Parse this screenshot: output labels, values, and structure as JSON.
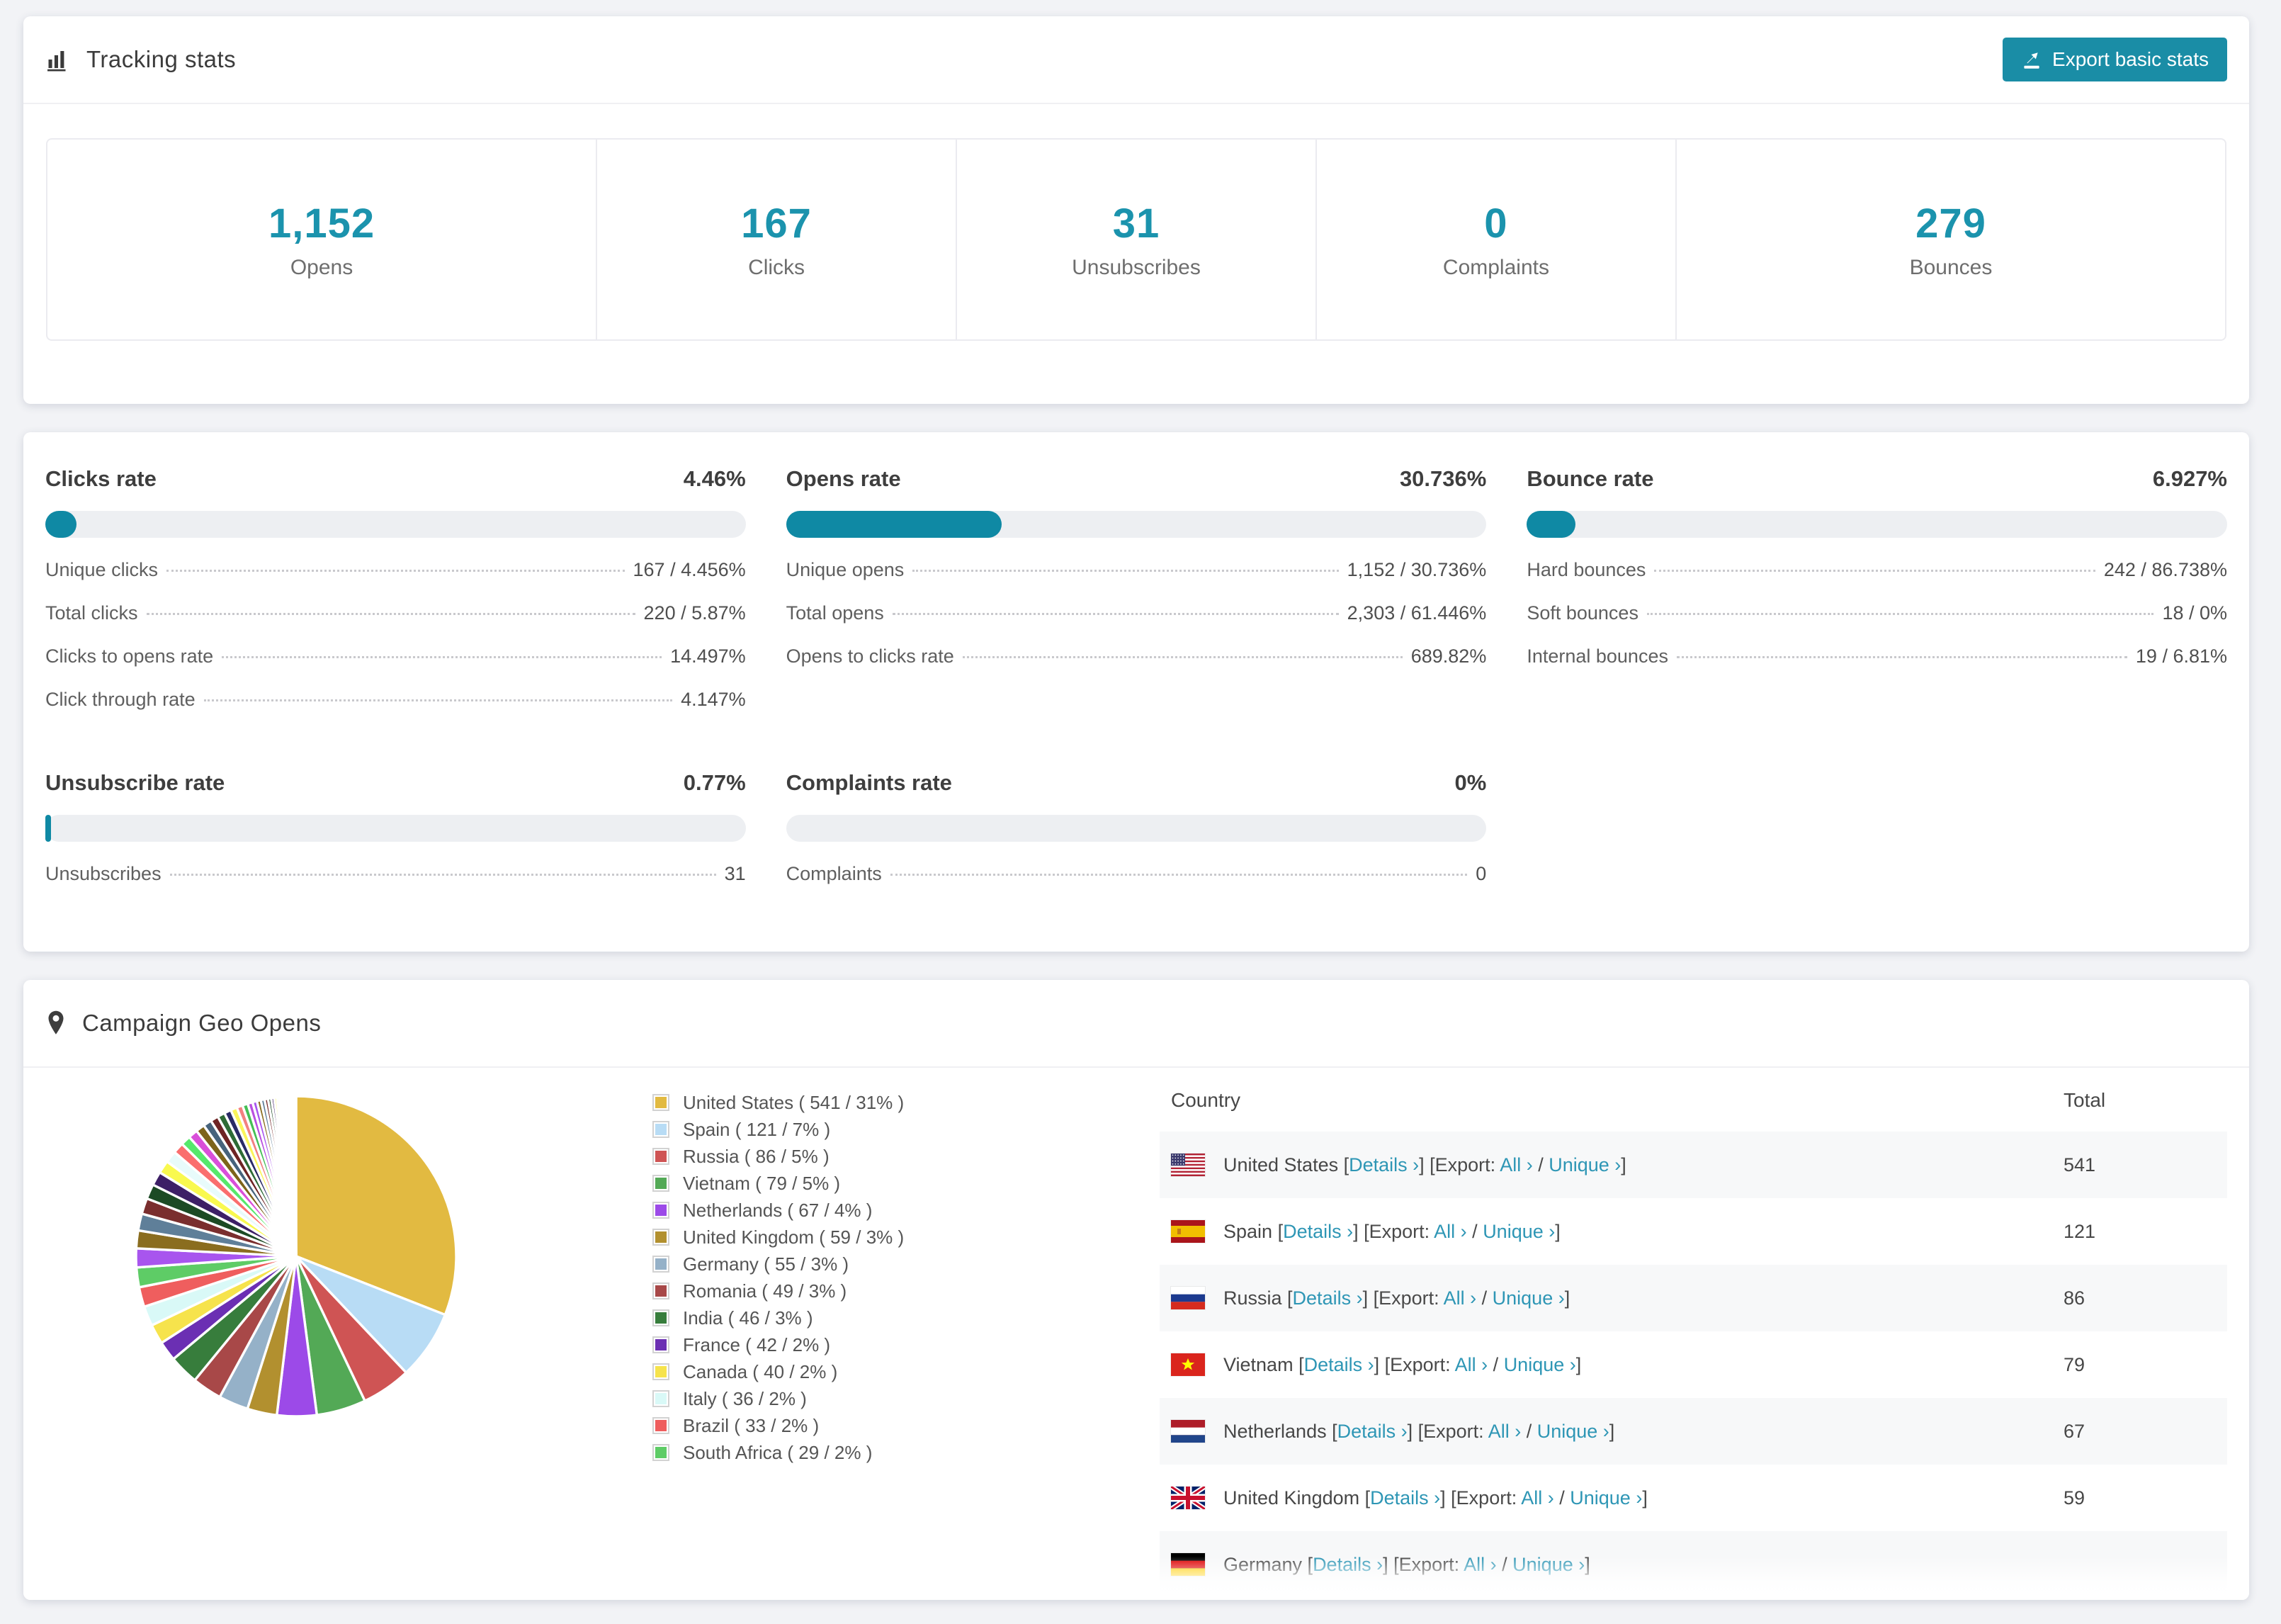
{
  "colors": {
    "accent_teal": "#1b93ad",
    "button_teal": "#1a8da6",
    "link_teal": "#2e96b5",
    "bar_fill": "#0f89a4",
    "bar_track": "#edeff2",
    "stripe_bg": "#f7f8f9"
  },
  "tracking": {
    "title": "Tracking stats",
    "icon": "bar-chart-icon",
    "export_button": {
      "label": "Export basic stats",
      "icon": "export-icon"
    },
    "stats": [
      {
        "value": "1,152",
        "label": "Opens"
      },
      {
        "value": "167",
        "label": "Clicks"
      },
      {
        "value": "31",
        "label": "Unsubscribes"
      },
      {
        "value": "0",
        "label": "Complaints"
      },
      {
        "value": "279",
        "label": "Bounces"
      }
    ]
  },
  "rates": {
    "cards": [
      {
        "title": "Clicks rate",
        "value": "4.46%",
        "bar_pct": 4.46,
        "rows": [
          {
            "label": "Unique clicks",
            "value": "167 / 4.456%"
          },
          {
            "label": "Total clicks",
            "value": "220 / 5.87%"
          },
          {
            "label": "Clicks to opens rate",
            "value": "14.497%"
          },
          {
            "label": "Click through rate",
            "value": "4.147%"
          }
        ]
      },
      {
        "title": "Opens rate",
        "value": "30.736%",
        "bar_pct": 30.736,
        "rows": [
          {
            "label": "Unique opens",
            "value": "1,152 / 30.736%"
          },
          {
            "label": "Total opens",
            "value": "2,303 / 61.446%"
          },
          {
            "label": "Opens to clicks rate",
            "value": "689.82%"
          }
        ]
      },
      {
        "title": "Bounce rate",
        "value": "6.927%",
        "bar_pct": 6.927,
        "rows": [
          {
            "label": "Hard bounces",
            "value": "242 / 86.738%"
          },
          {
            "label": "Soft bounces",
            "value": "18 / 0%"
          },
          {
            "label": "Internal bounces",
            "value": "19 / 6.81%"
          }
        ]
      },
      {
        "title": "Unsubscribe rate",
        "value": "0.77%",
        "bar_pct": 0.77,
        "rows": [
          {
            "label": "Unsubscribes",
            "value": "31"
          }
        ]
      },
      {
        "title": "Complaints rate",
        "value": "0%",
        "bar_pct": 0,
        "rows": [
          {
            "label": "Complaints",
            "value": "0"
          }
        ]
      }
    ]
  },
  "geo": {
    "title": "Campaign Geo Opens",
    "icon": "map-pin-icon",
    "table": {
      "headers": {
        "country": "Country",
        "total": "Total"
      },
      "row_text": {
        "details": "Details ›",
        "export_label": "Export:",
        "all": "All ›",
        "unique": "Unique ›"
      },
      "rows": [
        {
          "country": "United States",
          "flag": "us",
          "total": "541"
        },
        {
          "country": "Spain",
          "flag": "es",
          "total": "121"
        },
        {
          "country": "Russia",
          "flag": "ru",
          "total": "86"
        },
        {
          "country": "Vietnam",
          "flag": "vn",
          "total": "79"
        },
        {
          "country": "Netherlands",
          "flag": "nl",
          "total": "67"
        },
        {
          "country": "United Kingdom",
          "flag": "gb",
          "total": "59"
        },
        {
          "country": "Germany",
          "flag": "de",
          "total": "",
          "partial": true
        }
      ]
    }
  },
  "chart_data": {
    "type": "pie",
    "title": "Campaign Geo Opens",
    "legend_position": "right",
    "start_angle_deg": -90,
    "direction": "clockwise",
    "legend_format": "Label ( value / pct% )",
    "labels": [
      "United States",
      "Spain",
      "Russia",
      "Vietnam",
      "Netherlands",
      "United Kingdom",
      "Germany",
      "Romania",
      "India",
      "France",
      "Canada",
      "Italy",
      "Brazil",
      "South Africa"
    ],
    "values": [
      541,
      121,
      86,
      79,
      67,
      59,
      55,
      49,
      46,
      42,
      40,
      36,
      33,
      29
    ],
    "pct": [
      31,
      7,
      5,
      5,
      4,
      3,
      3,
      3,
      3,
      2,
      2,
      2,
      2,
      2
    ],
    "colors": [
      "#e2ba41",
      "#b8dcf5",
      "#cf5454",
      "#53a956",
      "#9c4ae8",
      "#b2902f",
      "#95b1c8",
      "#a84848",
      "#377d3c",
      "#6b2fb3",
      "#f6e34c",
      "#d9f9f7",
      "#ef5e5e",
      "#5ecc66"
    ],
    "unlabeled_tail_pct": [
      1.9,
      1.8,
      1.7,
      1.6,
      1.5,
      1.4,
      1.3,
      1.2,
      1.1,
      1.0,
      0.95,
      0.9,
      0.85,
      0.8,
      0.75,
      0.7,
      0.65,
      0.6,
      0.55,
      0.5,
      0.45,
      0.4,
      0.38,
      0.35,
      0.32,
      0.3,
      0.28,
      0.26,
      0.24,
      0.22,
      0.2,
      0.18,
      0.16,
      0.14,
      0.12,
      0.1,
      0.09,
      0.08,
      0.07,
      0.06
    ],
    "tail_palette": [
      "#a855ee",
      "#8a6d1f",
      "#5f7f99",
      "#7a2e2e",
      "#1c4a24",
      "#3d1f66",
      "#f9f94f",
      "#e8fbfb",
      "#fa6e6e",
      "#56e86b",
      "#d94fd9",
      "#7d641a",
      "#46637c",
      "#6e2424",
      "#2e6b35",
      "#2a2a66",
      "#fbf55a",
      "#f28080",
      "#44bf55",
      "#b94fe0"
    ]
  }
}
